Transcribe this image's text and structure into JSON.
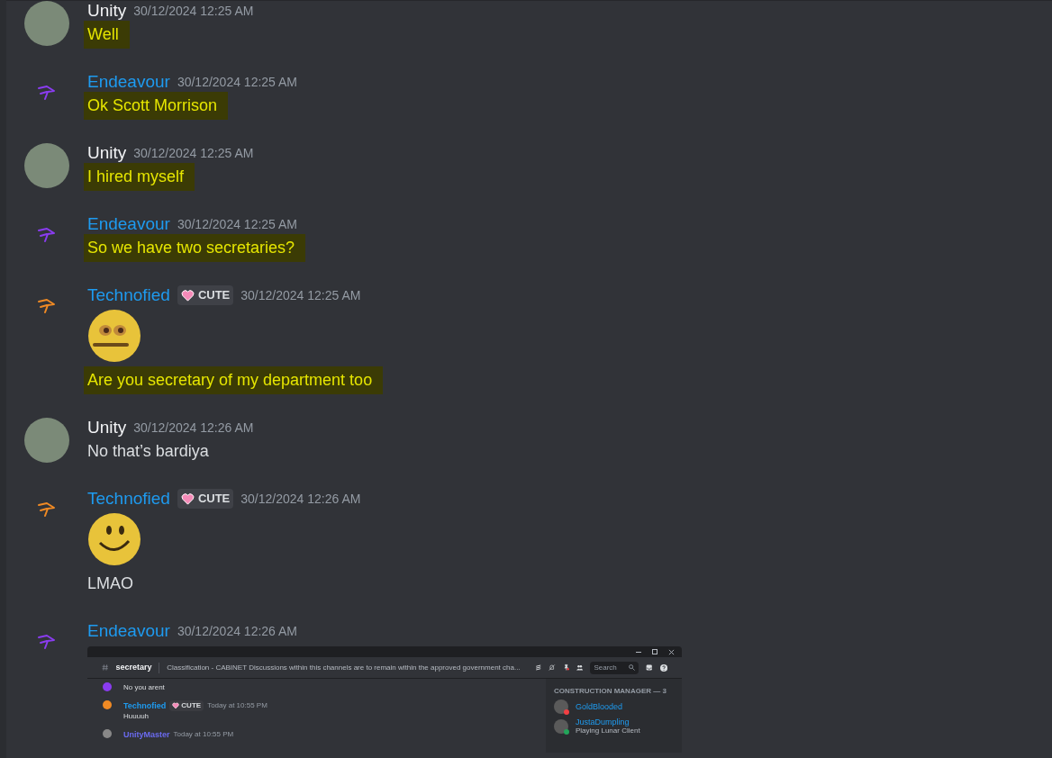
{
  "messages": [
    {
      "author": {
        "name": "Unity",
        "color": "#f2f3f5"
      },
      "avatar": {
        "kind": "photo"
      },
      "timestamp": "30/12/2024 12:25 AM",
      "lines": [
        {
          "kind": "text",
          "text": "Well",
          "highlighted": true
        }
      ]
    },
    {
      "author": {
        "name": "Endeavour",
        "color": "#1e9bf0"
      },
      "avatar": {
        "kind": "logo",
        "color": "#8a3cf0"
      },
      "timestamp": "30/12/2024 12:25 AM",
      "lines": [
        {
          "kind": "text",
          "text": "Ok Scott Morrison",
          "highlighted": true
        }
      ]
    },
    {
      "author": {
        "name": "Unity",
        "color": "#f2f3f5"
      },
      "avatar": {
        "kind": "photo"
      },
      "timestamp": "30/12/2024 12:25 AM",
      "lines": [
        {
          "kind": "text",
          "text": "I hired myself",
          "highlighted": true
        }
      ]
    },
    {
      "author": {
        "name": "Endeavour",
        "color": "#1e9bf0"
      },
      "avatar": {
        "kind": "logo",
        "color": "#8a3cf0"
      },
      "timestamp": "30/12/2024 12:25 AM",
      "lines": [
        {
          "kind": "text",
          "text": "So we have two secretaries?",
          "highlighted": true
        }
      ]
    },
    {
      "author": {
        "name": "Technofied",
        "color": "#1e9bf0"
      },
      "avatar": {
        "kind": "logo",
        "color": "#f08a24"
      },
      "badge": "CUTE",
      "timestamp": "30/12/2024 12:25 AM",
      "lines": [
        {
          "kind": "flatemoji"
        },
        {
          "kind": "text",
          "text": "Are you secretary of my department too",
          "highlighted": true
        }
      ]
    },
    {
      "author": {
        "name": "Unity",
        "color": "#f2f3f5"
      },
      "avatar": {
        "kind": "photo"
      },
      "timestamp": "30/12/2024 12:26 AM",
      "lines": [
        {
          "kind": "text",
          "text": "No that’s bardiya",
          "highlighted": false
        }
      ]
    },
    {
      "author": {
        "name": "Technofied",
        "color": "#1e9bf0"
      },
      "avatar": {
        "kind": "logo",
        "color": "#f08a24"
      },
      "badge": "CUTE",
      "timestamp": "30/12/2024 12:26 AM",
      "lines": [
        {
          "kind": "smileemoji"
        },
        {
          "kind": "text",
          "text": "LMAO",
          "highlighted": false
        }
      ]
    },
    {
      "author": {
        "name": "Endeavour",
        "color": "#1e9bf0"
      },
      "avatar": {
        "kind": "logo",
        "color": "#8a3cf0"
      },
      "timestamp": "30/12/2024 12:26 AM",
      "lines": [
        {
          "kind": "screenshot"
        }
      ]
    }
  ],
  "embedded_screenshot": {
    "channel": "secretary",
    "topic": "Classification - CABINET Discussions within this channels are to remain within the approved government cha...",
    "search": {
      "placeholder": "Search"
    },
    "messages": [
      {
        "avatar": {
          "color": "#8a3cf0"
        },
        "text": "No you arent"
      },
      {
        "author": {
          "name": "Technofied",
          "color": "#1e9bf0"
        },
        "avatar": {
          "color": "#f08a24"
        },
        "badge": "CUTE",
        "timestamp": "Today at 10:55 PM",
        "text": "Huuuuh"
      },
      {
        "author": {
          "name": "UnityMaster",
          "color": "#6b6bf0"
        },
        "avatar": {
          "color": "#888888"
        },
        "timestamp": "Today at 10:55 PM"
      }
    ],
    "member_group": "CONSTRUCTION MANAGER — 3",
    "members": [
      {
        "name": "GoldBlooded",
        "status": {
          "color": "#f23f43"
        }
      },
      {
        "name": "JustaDumpling",
        "activity": "Playing Lunar Client",
        "status": {
          "color": "#23a55a"
        }
      }
    ]
  }
}
